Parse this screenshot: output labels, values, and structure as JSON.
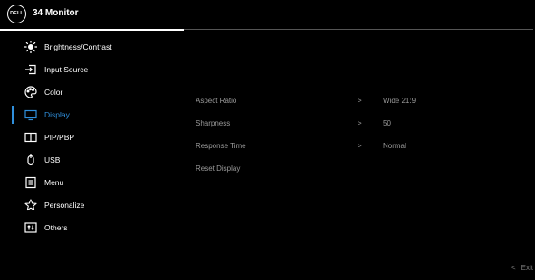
{
  "header": {
    "logo_text": "DELL",
    "title": "34 Monitor"
  },
  "menu": [
    {
      "label": "Brightness/Contrast",
      "icon": "brightness-icon",
      "active": false
    },
    {
      "label": "Input Source",
      "icon": "input-source-icon",
      "active": false
    },
    {
      "label": "Color",
      "icon": "color-palette-icon",
      "active": false
    },
    {
      "label": "Display",
      "icon": "display-icon",
      "active": true
    },
    {
      "label": "PIP/PBP",
      "icon": "pip-pbp-icon",
      "active": false
    },
    {
      "label": "USB",
      "icon": "usb-mouse-icon",
      "active": false
    },
    {
      "label": "Menu",
      "icon": "menu-list-icon",
      "active": false
    },
    {
      "label": "Personalize",
      "icon": "star-icon",
      "active": false
    },
    {
      "label": "Others",
      "icon": "others-icon",
      "active": false
    }
  ],
  "display_settings": [
    {
      "name": "Aspect Ratio",
      "arrow": ">",
      "value": "Wide 21:9"
    },
    {
      "name": "Sharpness",
      "arrow": ">",
      "value": "50"
    },
    {
      "name": "Response Time",
      "arrow": ">",
      "value": "Normal"
    },
    {
      "name": "Reset Display",
      "arrow": "",
      "value": ""
    }
  ],
  "footer": {
    "exit_chevron": "<",
    "exit_label": "Exit"
  },
  "colors": {
    "accent": "#2f8fdc",
    "background": "#000000",
    "text": "#ffffff",
    "muted": "#9a9a9a"
  }
}
